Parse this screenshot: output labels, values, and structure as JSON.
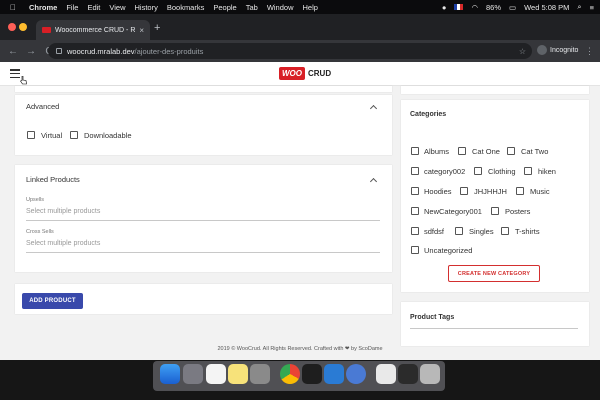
{
  "menubar": {
    "apple": "",
    "items": [
      "Chrome",
      "File",
      "Edit",
      "View",
      "History",
      "Bookmarks",
      "People",
      "Tab",
      "Window",
      "Help"
    ],
    "battery": "86%",
    "clock": "Wed 5:08 PM"
  },
  "browser": {
    "tab_title": "Woocommerce CRUD - ReactJS",
    "tab_close": "×",
    "new_tab": "+",
    "url_host": "woocrud.mralab.dev",
    "url_path": "/ajouter-des-produits",
    "star": "☆",
    "profile": "Incognito",
    "more": "⋮",
    "back": "←",
    "forward": "→",
    "reload": "C"
  },
  "app": {
    "logo_woo": "WOO",
    "logo_crud": "CRUD"
  },
  "advanced": {
    "title": "Advanced",
    "virtual": "Virtual",
    "downloadable": "Downloadable"
  },
  "linked": {
    "title": "Linked Products",
    "upsells_label": "Upsells",
    "upsells_placeholder": "Select multiple products",
    "crosssells_label": "Cross Sells",
    "crosssells_placeholder": "Select multiple products"
  },
  "add_product": "ADD PRODUCT",
  "categories": {
    "title": "Categories",
    "rows": [
      [
        "Albums",
        "Cat One",
        "Cat Two"
      ],
      [
        "category002",
        "Clothing",
        "hiken"
      ],
      [
        "Hoodies",
        "JHJHHJH",
        "Music"
      ],
      [
        "NewCategory001",
        "Posters"
      ],
      [
        "sdfdsf",
        "Singles",
        "T-shirts"
      ],
      [
        "Uncategorized"
      ]
    ],
    "create_button": "CREATE NEW CATEGORY"
  },
  "product_tags": {
    "title": "Product Tags"
  },
  "footer": "2019 © WooCrud. All Rights Reserved. Crafted with ❤ by ScoDame"
}
